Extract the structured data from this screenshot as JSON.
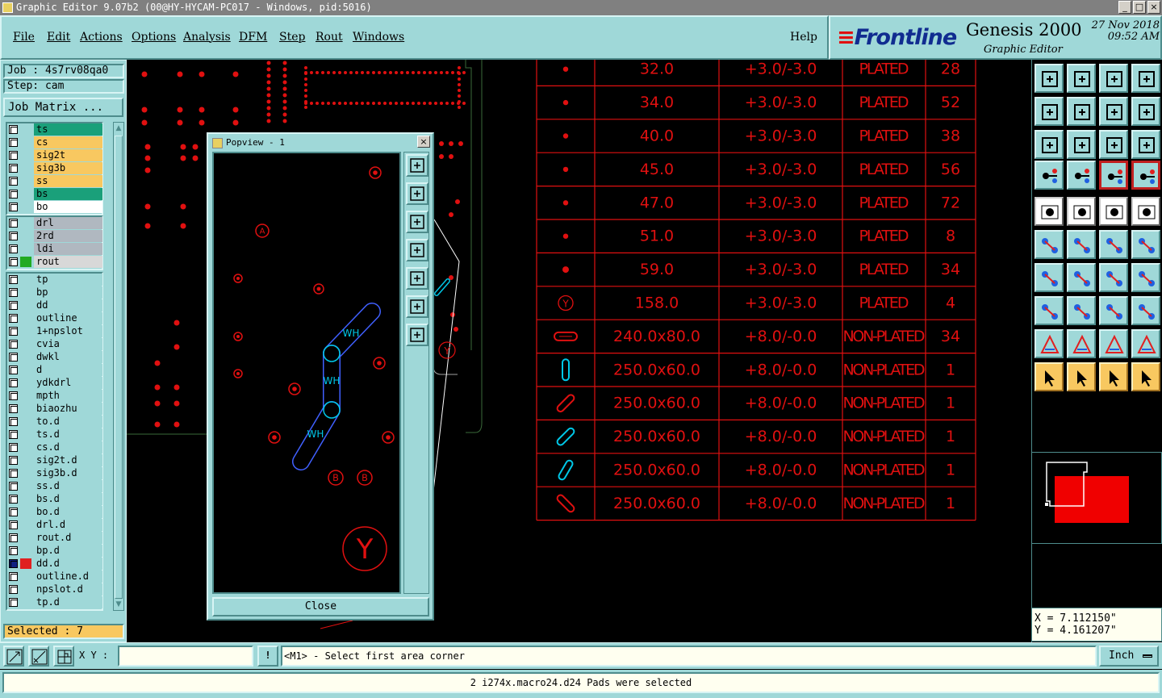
{
  "window": {
    "title": "Graphic Editor 9.07b2 (00@HY-HYCAM-PC017 - Windows, pid:5016)"
  },
  "menu": {
    "items": [
      "File",
      "Edit",
      "Actions",
      "Options",
      "Analysis",
      "DFM",
      "Step",
      "Rout",
      "Windows"
    ],
    "help": "Help"
  },
  "brand": {
    "logo": "Frontline",
    "product": "Genesis 2000",
    "subtitle": "Graphic Editor",
    "date": "27 Nov 2018",
    "time": "09:52 AM"
  },
  "job": {
    "job_label": "Job : 4s7rv08qa0",
    "step_label": "Step: cam",
    "matrix_button": "Job Matrix ..."
  },
  "layers": {
    "group1": [
      {
        "name": "ts",
        "color": "#1aa07a"
      },
      {
        "name": "cs",
        "color": "#f8c860"
      },
      {
        "name": "sig2t",
        "color": "#f8c860"
      },
      {
        "name": "sig3b",
        "color": "#f8c860"
      },
      {
        "name": "ss",
        "color": "#f8c860"
      },
      {
        "name": "bs",
        "color": "#1aa07a"
      },
      {
        "name": "bo",
        "color": "#ffffff"
      }
    ],
    "group2": [
      {
        "name": "drl",
        "color": "#b0b8c0"
      },
      {
        "name": "2rd",
        "color": "#b0b8c0"
      },
      {
        "name": "ldi",
        "color": "#b0b8c0"
      },
      {
        "name": "rout",
        "color": "#d8d8d8"
      }
    ],
    "group3": [
      {
        "name": "tp"
      },
      {
        "name": "bp"
      },
      {
        "name": "dd"
      },
      {
        "name": "outline"
      },
      {
        "name": "1+npslot"
      },
      {
        "name": "cvia"
      },
      {
        "name": "dwkl"
      },
      {
        "name": "d"
      },
      {
        "name": "ydkdrl"
      },
      {
        "name": "mpth"
      },
      {
        "name": "biaozhu"
      },
      {
        "name": "to.d"
      },
      {
        "name": "ts.d"
      },
      {
        "name": "cs.d"
      },
      {
        "name": "sig2t.d"
      },
      {
        "name": "sig3b.d"
      },
      {
        "name": "ss.d"
      },
      {
        "name": "bs.d"
      },
      {
        "name": "bo.d"
      },
      {
        "name": "drl.d"
      },
      {
        "name": "rout.d"
      },
      {
        "name": "bp.d"
      },
      {
        "name": "dd.d"
      },
      {
        "name": "outline.d"
      },
      {
        "name": "npslot.d"
      },
      {
        "name": "tp.d"
      }
    ]
  },
  "selected": "Selected : 7",
  "popview": {
    "title": "Popview - 1",
    "close_label": "Close",
    "labels": {
      "wh1": "WH",
      "wh2": "WH",
      "wh3": "WH",
      "a": "A",
      "b1": "B",
      "b2": "B",
      "y": "Y"
    }
  },
  "drill_table": {
    "rows": [
      {
        "symbol": "dot",
        "size": "32.0",
        "tol": "+3.0/-3.0",
        "type": "PLATED",
        "count": "28"
      },
      {
        "symbol": "dot",
        "size": "34.0",
        "tol": "+3.0/-3.0",
        "type": "PLATED",
        "count": "52"
      },
      {
        "symbol": "dot",
        "size": "40.0",
        "tol": "+3.0/-3.0",
        "type": "PLATED",
        "count": "38"
      },
      {
        "symbol": "dot",
        "size": "45.0",
        "tol": "+3.0/-3.0",
        "type": "PLATED",
        "count": "56"
      },
      {
        "symbol": "dot",
        "size": "47.0",
        "tol": "+3.0/-3.0",
        "type": "PLATED",
        "count": "72"
      },
      {
        "symbol": "dot",
        "size": "51.0",
        "tol": "+3.0/-3.0",
        "type": "PLATED",
        "count": "8"
      },
      {
        "symbol": "dot",
        "size": "59.0",
        "tol": "+3.0/-3.0",
        "type": "PLATED",
        "count": "34"
      },
      {
        "symbol": "Y",
        "size": "158.0",
        "tol": "+3.0/-3.0",
        "type": "PLATED",
        "count": "4"
      },
      {
        "symbol": "slot-h",
        "size": "240.0x80.0",
        "tol": "+8.0/-0.0",
        "type": "NON-PLATED",
        "count": "34"
      },
      {
        "symbol": "slot-v",
        "size": "250.0x60.0",
        "tol": "+8.0/-0.0",
        "type": "NON-PLATED",
        "count": "1"
      },
      {
        "symbol": "slot-d1",
        "size": "250.0x60.0",
        "tol": "+8.0/-0.0",
        "type": "NON-PLATED",
        "count": "1"
      },
      {
        "symbol": "slot-d2",
        "size": "250.0x60.0",
        "tol": "+8.0/-0.0",
        "type": "NON-PLATED",
        "count": "1"
      },
      {
        "symbol": "slot-d3",
        "size": "250.0x60.0",
        "tol": "+8.0/-0.0",
        "type": "NON-PLATED",
        "count": "1"
      },
      {
        "symbol": "slot-d4",
        "size": "250.0x60.0",
        "tol": "+8.0/-0.0",
        "type": "NON-PLATED",
        "count": "1"
      }
    ]
  },
  "coords": {
    "x": "X = 7.112150\"",
    "y": "Y = 4.161207\""
  },
  "bottom": {
    "xy_label": "X Y :",
    "xy_value": "",
    "prompt": "<M1> - Select first area corner",
    "unit": "Inch",
    "excl": "!"
  },
  "status": "2 i274x.macro24.d24 Pads were selected",
  "colors": {
    "panel": "#9fd8d8",
    "drawing": "#e01010",
    "highlight": "#00c8e8",
    "selected": "#4060ff"
  }
}
